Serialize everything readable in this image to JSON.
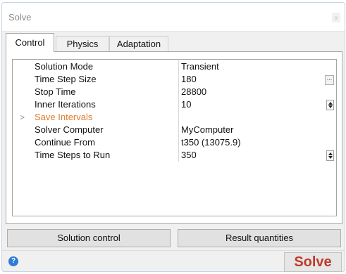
{
  "window": {
    "title": "Solve",
    "close_glyph": "x"
  },
  "tabs": [
    {
      "label": "Control",
      "active": true
    },
    {
      "label": "Physics",
      "active": false
    },
    {
      "label": "Adaptation",
      "active": false
    }
  ],
  "properties": [
    {
      "name": "Solution Mode",
      "value": "Transient",
      "control": "none"
    },
    {
      "name": "Time Step Size",
      "value": "180",
      "control": "ellipsis-button"
    },
    {
      "name": "Stop Time",
      "value": "28800",
      "control": "none"
    },
    {
      "name": "Inner Iterations",
      "value": "10",
      "control": "spin-button"
    },
    {
      "name": "Save Intervals",
      "value": "",
      "control": "expander",
      "highlight_color": "#e07b2a"
    },
    {
      "name": "Solver Computer",
      "value": "MyComputer",
      "control": "none"
    },
    {
      "name": "Continue From",
      "value": "t350 (13075.9)",
      "control": "none"
    },
    {
      "name": "Time Steps to Run",
      "value": "350",
      "control": "spin-button"
    }
  ],
  "expander_glyph": ">",
  "ellipsis_glyph": "...",
  "buttons": {
    "solution_control": "Solution control",
    "result_quantities": "Result quantities",
    "solve": "Solve"
  },
  "help_icon_glyph": "?",
  "colors": {
    "solve_text": "#c0392b",
    "help_icon": "#2f7bd6",
    "save_intervals": "#e07b2a"
  }
}
